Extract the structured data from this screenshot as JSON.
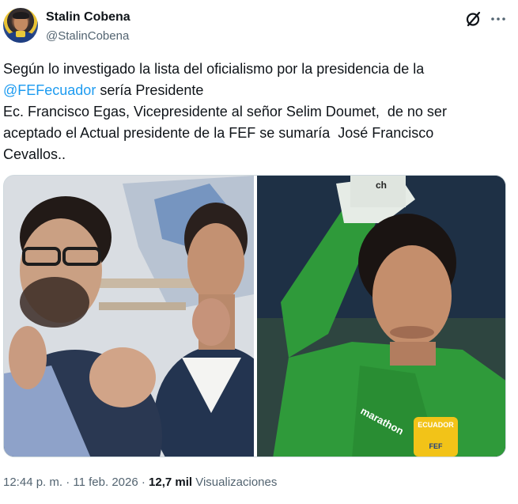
{
  "author": {
    "name": "Stalin Cobena",
    "handle": "@StalinCobena"
  },
  "icons": {
    "grok": "grok-icon",
    "more": "more-icon"
  },
  "tweet": {
    "line1": "Según lo investigado la lista del oficialismo por la presidencia de la",
    "mention": "@FEFecuador",
    "line2_rest": " sería Presidente",
    "line3": "Ec. Francisco Egas, Vicepresidente al señor Selim Doumet,  de no ser",
    "line4": "aceptado el Actual presidente de la FEF se sumaría  José Francisco",
    "line5": "Cevallos.."
  },
  "media": {
    "photo_right_crest_text": "ECUADOR",
    "photo_right_shirt_text": "FEF",
    "photo_right_glove_text": "ch",
    "photo_right_sponsor_text": "marathon"
  },
  "meta": {
    "time": "12:44 p. m.",
    "separator1": " · ",
    "date": "11 feb. 2026",
    "separator2": " · ",
    "views_count": "12,7 mil",
    "views_label": " Visualizaciones"
  },
  "colors": {
    "link": "#1d9bf0",
    "text": "#0f1419",
    "muted": "#536471",
    "keeper_jersey": "#2f9a3a"
  }
}
